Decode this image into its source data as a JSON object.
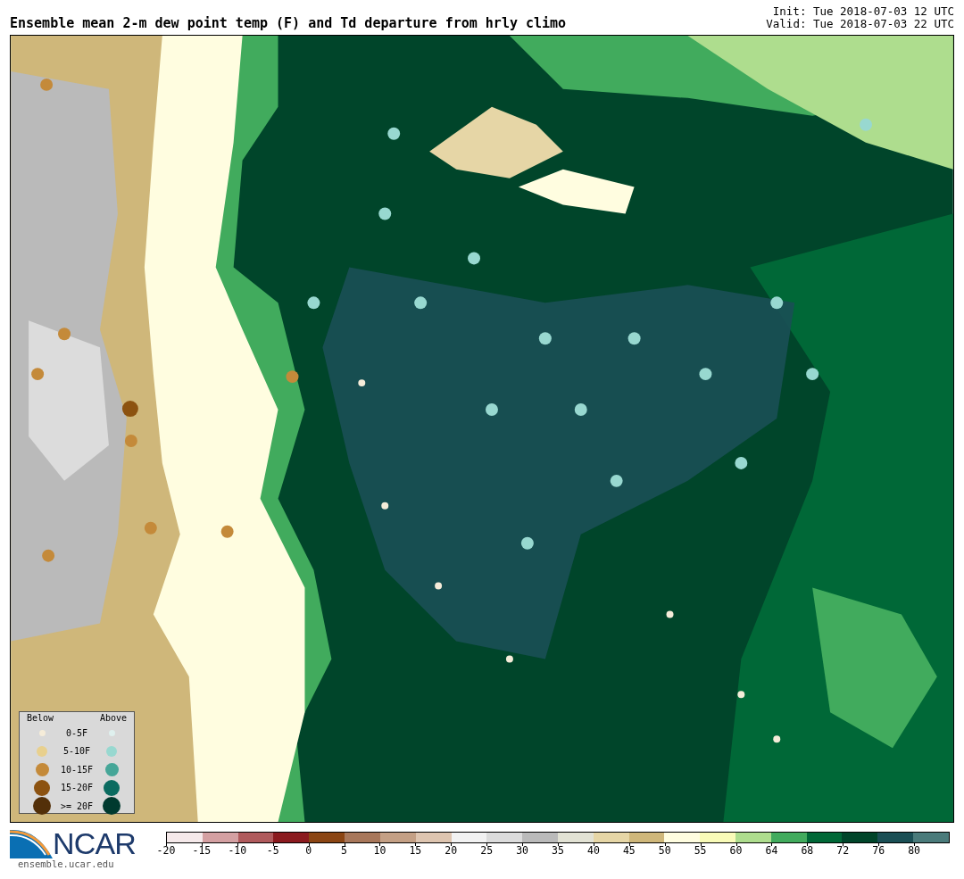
{
  "title": "Ensemble mean 2-m dew point temp (F) and Td departure from hrly climo",
  "init": "Init: Tue 2018-07-03 12 UTC",
  "valid": "Valid: Tue 2018-07-03 22 UTC",
  "legend": {
    "below_header": "Below",
    "above_header": "Above",
    "rows": [
      {
        "label": "0-5F",
        "below": {
          "color": "#f5ecd9"
        },
        "above": {
          "color": "#dff0ee"
        }
      },
      {
        "label": "5-10F",
        "below": {
          "color": "#e8d08e"
        },
        "above": {
          "color": "#98d8d0"
        }
      },
      {
        "label": "10-15F",
        "below": {
          "color": "#c48a3a"
        },
        "above": {
          "color": "#46a698"
        }
      },
      {
        "label": "15-20F",
        "below": {
          "color": "#8c5210"
        },
        "above": {
          "color": "#0a6b60"
        }
      },
      {
        "label": ">= 20F",
        "below": {
          "color": "#533009"
        },
        "above": {
          "color": "#003a2f"
        }
      }
    ]
  },
  "logo": {
    "name": "NCAR",
    "url": "ensemble.ucar.edu"
  },
  "colorbar": {
    "segments": [
      {
        "color": "#f5e9ea"
      },
      {
        "color": "#d4a0a2"
      },
      {
        "color": "#b05a5c"
      },
      {
        "color": "#8b1a1e"
      },
      {
        "color": "#8b4513"
      },
      {
        "color": "#a8775a"
      },
      {
        "color": "#c4a085"
      },
      {
        "color": "#dec5b0"
      },
      {
        "color": "#f2f2f2"
      },
      {
        "color": "#dcdcdc"
      },
      {
        "color": "#bababa"
      },
      {
        "color": "#e2e2d4"
      },
      {
        "color": "#e6d6a6"
      },
      {
        "color": "#cfb77a"
      },
      {
        "color": "#fffde0"
      },
      {
        "color": "#f9fbb8"
      },
      {
        "color": "#aedd8e"
      },
      {
        "color": "#41ab5d"
      },
      {
        "color": "#006837"
      },
      {
        "color": "#00452a"
      },
      {
        "color": "#1a4f55"
      },
      {
        "color": "#4a7b7b"
      }
    ],
    "ticks": [
      "-20",
      "-15",
      "-10",
      "-5",
      "0",
      "5",
      "10",
      "15",
      "20",
      "25",
      "30",
      "35",
      "40",
      "45",
      "50",
      "55",
      "60",
      "64",
      "68",
      "72",
      "76",
      "80"
    ]
  }
}
